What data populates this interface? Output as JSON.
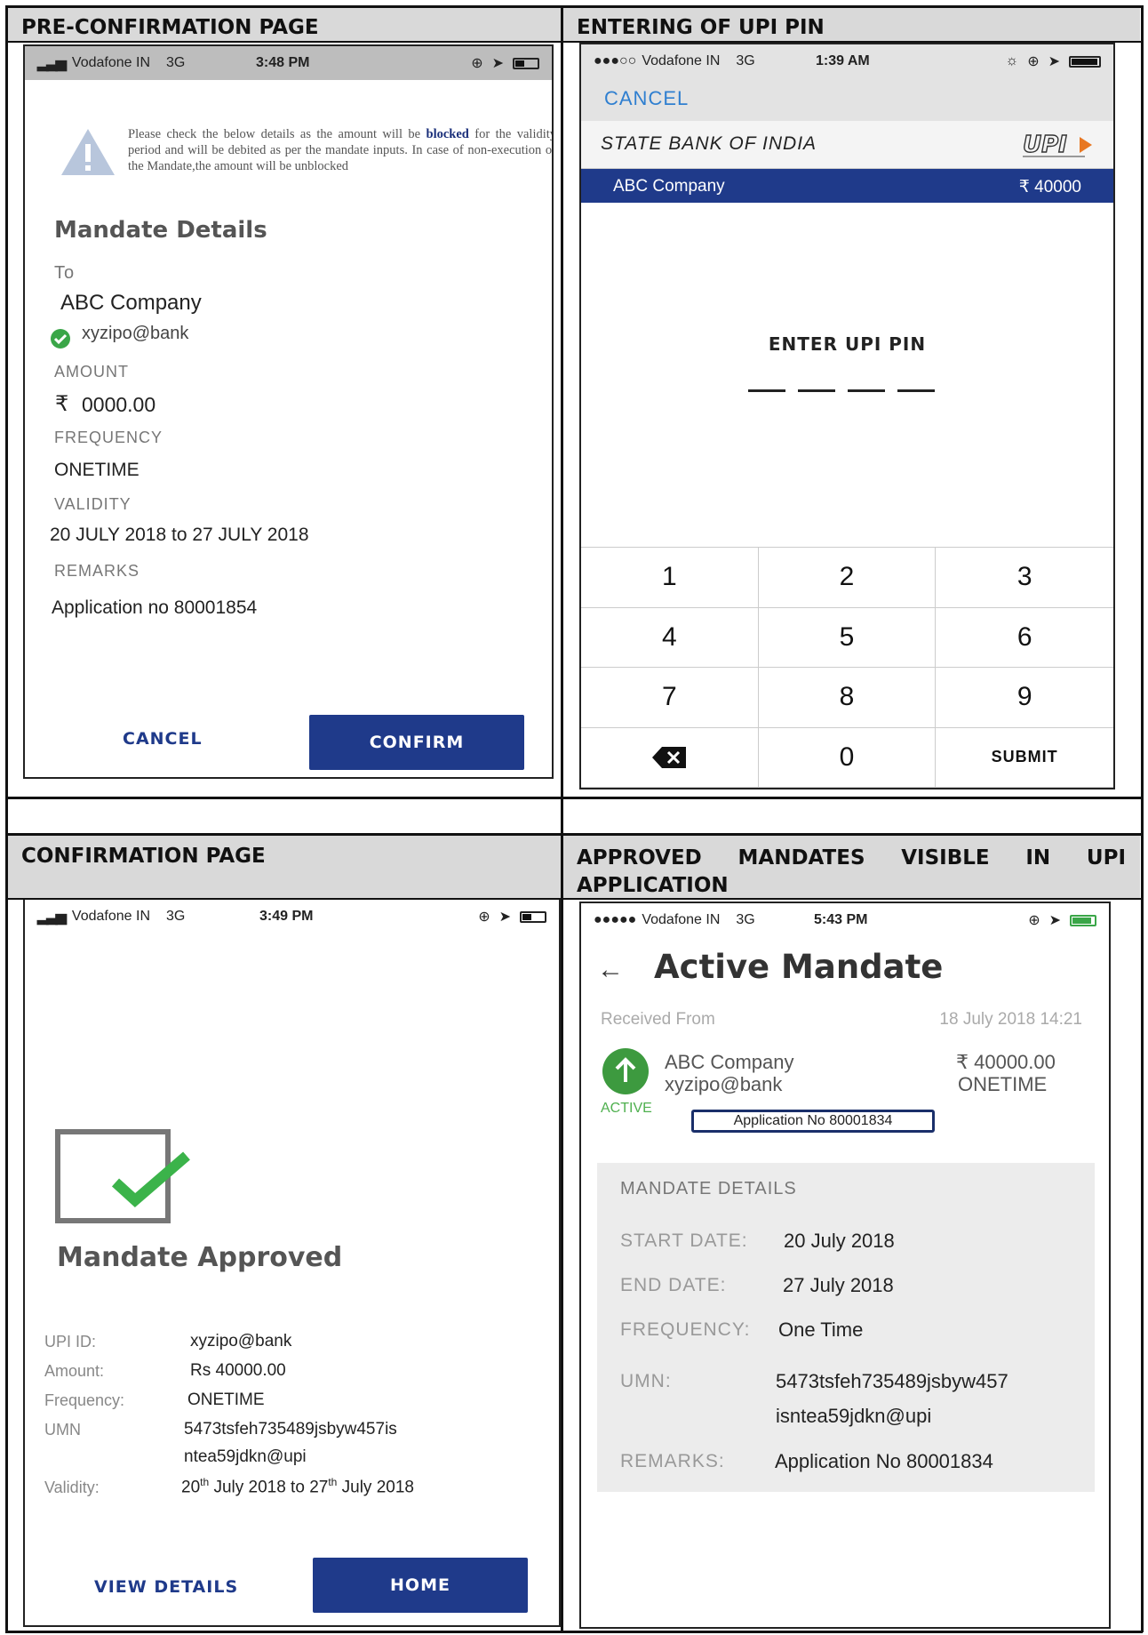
{
  "headers": {
    "top_left": "PRE-CONFIRMATION PAGE",
    "top_right": "ENTERING OF UPI PIN",
    "bottom_left": "CONFIRMATION PAGE",
    "bottom_right": "APPROVED MANDATES VISIBLE IN UPI APPLICATION"
  },
  "pre_confirmation": {
    "status": {
      "carrier": "Vodafone IN",
      "network": "3G",
      "time": "3:48 PM"
    },
    "warning_before": "Please check the below details as the amount will be",
    "warning_bold": "blocked",
    "warning_after": "for the validity period and will be debited as per the mandate inputs. In case of non-execution of the Mandate,the amount will be unblocked",
    "section_title": "Mandate Details",
    "to_label": "To",
    "to_value": "ABC Company",
    "vpa": "xyzipo@bank",
    "amount_label": "AMOUNT",
    "amount_symbol": "₹",
    "amount_value": "0000.00",
    "frequency_label": "FREQUENCY",
    "frequency_value": "ONETIME",
    "validity_label": "VALIDITY",
    "validity_value": "20 JULY 2018 to 27 JULY 2018",
    "remarks_label": "REMARKS",
    "remarks_value": "Application no 80001854",
    "cancel_label": "CANCEL",
    "confirm_label": "CONFIRM"
  },
  "upi_pin": {
    "status": {
      "carrier": "Vodafone IN",
      "network": "3G",
      "time": "1:39 AM"
    },
    "cancel_label": "CANCEL",
    "bank_name": "STATE BANK OF INDIA",
    "payee": "ABC Company",
    "amount": "₹ 40000",
    "prompt": "ENTER UPI PIN",
    "keys": [
      "1",
      "2",
      "3",
      "4",
      "5",
      "6",
      "7",
      "8",
      "9",
      "",
      "0",
      "SUBMIT"
    ]
  },
  "confirmation": {
    "status": {
      "carrier": "Vodafone IN",
      "network": "3G",
      "time": "3:49 PM"
    },
    "title": "Mandate Approved",
    "upi_id_label": "UPI ID:",
    "upi_id_value": "xyzipo@bank",
    "amount_label": "Amount:",
    "amount_value": "Rs 40000.00",
    "frequency_label": "Frequency:",
    "frequency_value": "ONETIME",
    "umn_label": "UMN",
    "umn_line1": "5473tsfeh735489jsbyw457is",
    "umn_line2": "ntea59jdkn@upi",
    "validity_label": "Validity:",
    "validity_start_day": "20",
    "validity_start_sup": "th",
    "validity_start_rest": "July 2018 to",
    "validity_end_day": "27",
    "validity_end_sup": "th",
    "validity_end_rest": "July 2018",
    "view_details_label": "VIEW DETAILS",
    "home_label": "HOME"
  },
  "active_mandate": {
    "status": {
      "carrier": "Vodafone IN",
      "network": "3G",
      "time": "5:43 PM"
    },
    "title": "Active Mandate",
    "received_label": "Received From",
    "received_time": "18 July 2018 14:21",
    "payee": "ABC Company",
    "vpa": "xyzipo@bank",
    "amount": "₹ 40000.00",
    "frequency": "ONETIME",
    "status_badge": "ACTIVE",
    "application": "Application No 80001834",
    "details_title": "MANDATE DETAILS",
    "start_label": "START DATE:",
    "start_value": "20 July 2018",
    "end_label": "END DATE:",
    "end_value": "27 July 2018",
    "freq_label": "FREQUENCY:",
    "freq_value": "One Time",
    "umn_label": "UMN:",
    "umn_line1": "5473tsfeh735489jsbyw457",
    "umn_line2": "isntea59jdkn@upi",
    "remarks_label": "REMARKS:",
    "remarks_value": "Application No 80001834"
  }
}
